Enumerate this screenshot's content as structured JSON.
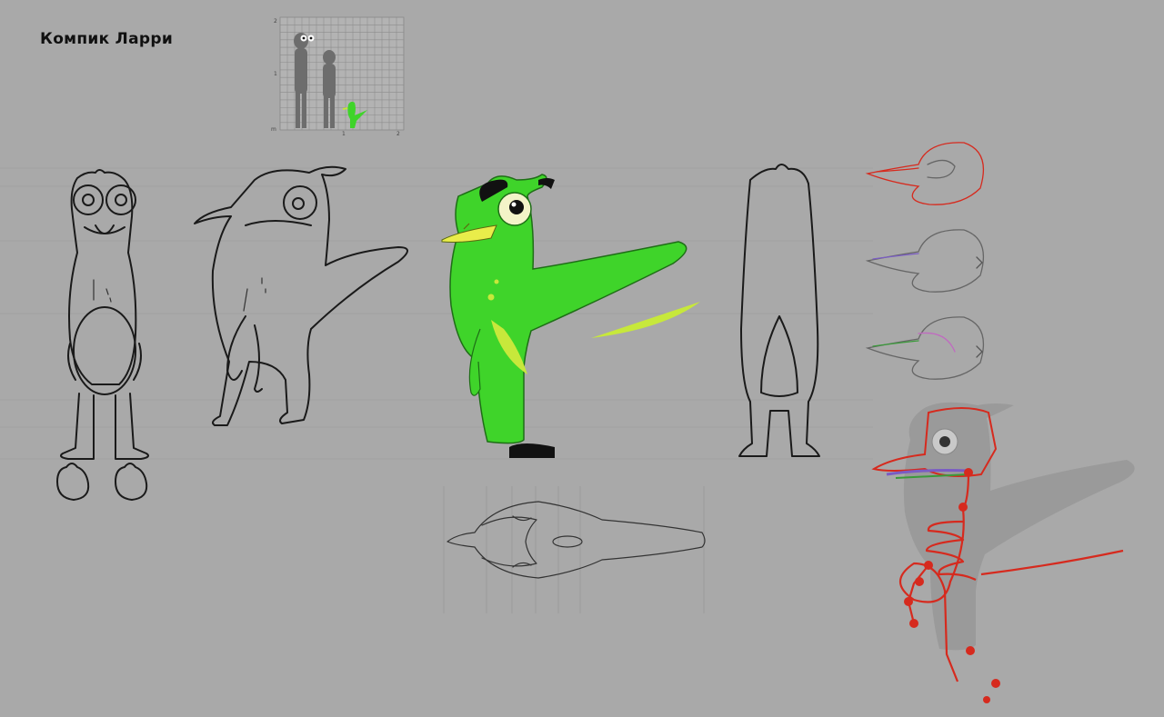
{
  "sheet": {
    "title": "Компик Ларри",
    "background_color": "#a9a9a9",
    "scale_chart": {
      "y_tick_labels": [
        "2",
        "1",
        "m"
      ],
      "x_tick_labels": [
        "1",
        "2"
      ]
    },
    "views": [
      {
        "name": "front-view",
        "icon": "character-front-lineart"
      },
      {
        "name": "side-view",
        "icon": "character-side-lineart"
      },
      {
        "name": "color-view",
        "icon": "character-color-green"
      },
      {
        "name": "back-view",
        "icon": "character-back-lineart"
      },
      {
        "name": "top-view",
        "icon": "character-top-lineart"
      },
      {
        "name": "skeleton-view",
        "icon": "character-skeleton-red"
      }
    ],
    "colors": {
      "body_green": "#3fd42a",
      "belly_yellow": "#c7e83b",
      "skeleton_red": "#d62a1e",
      "skull_purple": "#7a5cc4",
      "skull_green": "#3a9b3a"
    }
  }
}
